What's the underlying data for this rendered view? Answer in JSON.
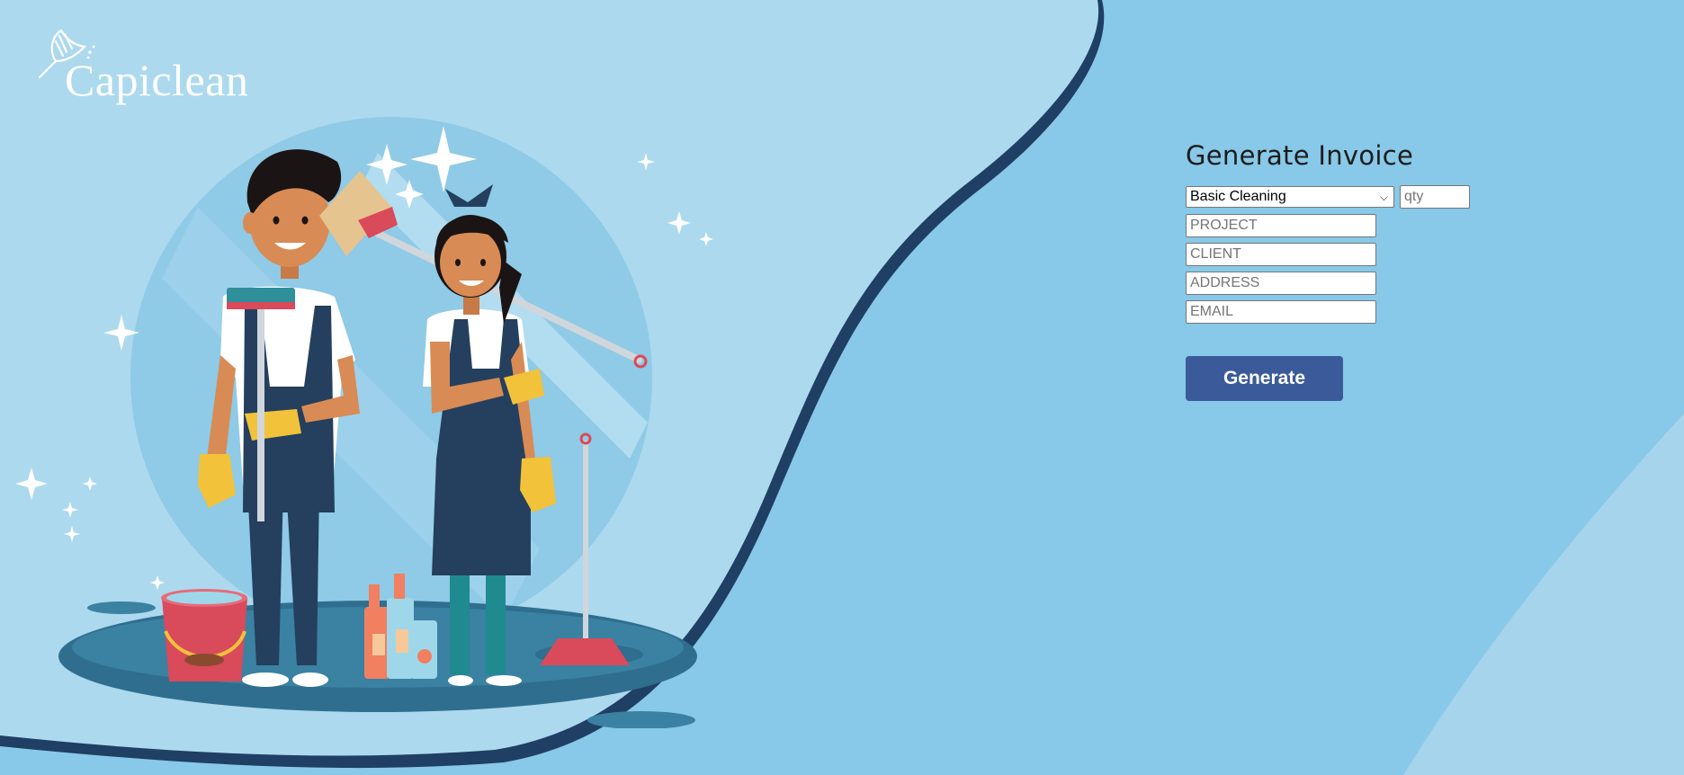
{
  "brand": {
    "name": "Capiclean"
  },
  "form": {
    "title": "Generate Invoice",
    "service_select": {
      "selected": "Basic Cleaning"
    },
    "qty": {
      "placeholder": "qty",
      "value": ""
    },
    "project": {
      "placeholder": "PROJECT",
      "value": ""
    },
    "client": {
      "placeholder": "CLIENT",
      "value": ""
    },
    "address": {
      "placeholder": "ADDRESS",
      "value": ""
    },
    "email": {
      "placeholder": "EMAIL",
      "value": ""
    },
    "generate_label": "Generate"
  },
  "colors": {
    "background": "#88c8e8",
    "wave_light": "#acd9ee",
    "wave_shadow": "#1f3f64",
    "button": "#3b5a9a",
    "button_text": "#ffffff"
  },
  "icons": {
    "logo_mark": "feather-duster-icon",
    "select_caret": "chevron-down-icon"
  }
}
